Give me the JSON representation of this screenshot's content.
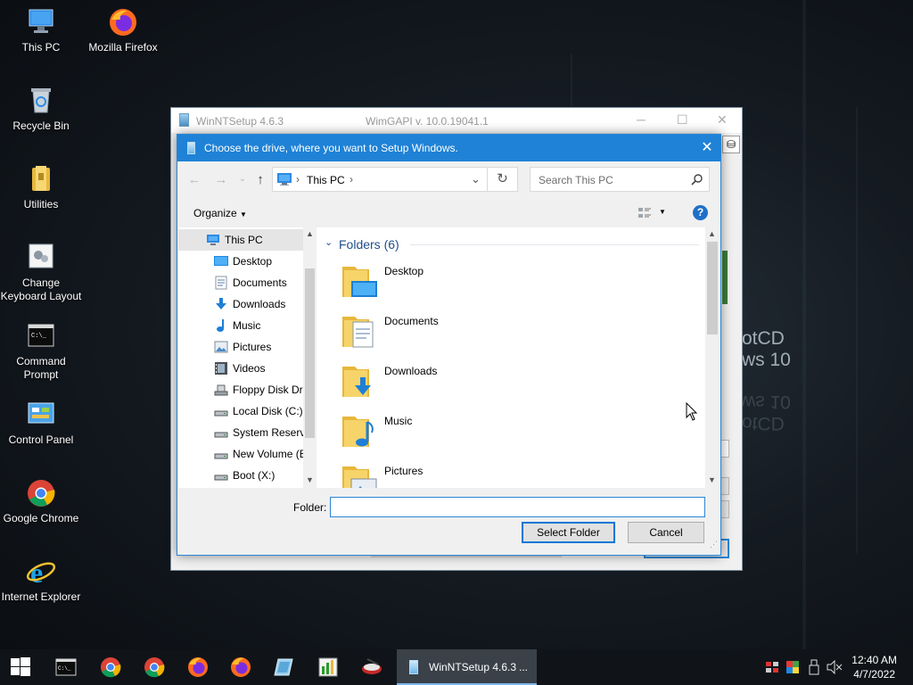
{
  "desktop": {
    "icons": [
      {
        "label": "This PC",
        "icon": "this-pc-icon"
      },
      {
        "label": "Mozilla Firefox",
        "icon": "firefox-icon"
      },
      {
        "label": "Recycle Bin",
        "icon": "recycle-bin-icon"
      },
      {
        "label": "Utilities",
        "icon": "folder-icon"
      },
      {
        "label": "Change Keyboard Layout",
        "icon": "keyboard-icon"
      },
      {
        "label": "Command Prompt",
        "icon": "cmd-icon"
      },
      {
        "label": "Control Panel",
        "icon": "control-panel-icon"
      },
      {
        "label": "Google Chrome",
        "icon": "chrome-icon"
      },
      {
        "label": "Internet Explorer",
        "icon": "ie-icon"
      }
    ],
    "wallpaper_text": "otCD\nws 10"
  },
  "background_window": {
    "title": "WinNTSetup 4.6.3",
    "subtitle": "WimGAPI v. 10.0.19041.1"
  },
  "dialog": {
    "title": "Choose the drive, where you want to Setup Windows.",
    "address": {
      "root": "This PC"
    },
    "search_placeholder": "Search This PC",
    "organize_label": "Organize",
    "help_label": "?",
    "tree": [
      {
        "label": "This PC",
        "icon": "this-pc-icon",
        "selected": true
      },
      {
        "label": "Desktop",
        "icon": "desktop-folder-icon"
      },
      {
        "label": "Documents",
        "icon": "documents-icon"
      },
      {
        "label": "Downloads",
        "icon": "downloads-icon"
      },
      {
        "label": "Music",
        "icon": "music-icon"
      },
      {
        "label": "Pictures",
        "icon": "pictures-icon"
      },
      {
        "label": "Videos",
        "icon": "videos-icon"
      },
      {
        "label": "Floppy Disk Dri",
        "icon": "floppy-drive-icon"
      },
      {
        "label": "Local Disk (C:)",
        "icon": "drive-icon"
      },
      {
        "label": "System Reserve",
        "icon": "drive-icon"
      },
      {
        "label": "New Volume (E",
        "icon": "drive-icon"
      },
      {
        "label": "Boot (X:)",
        "icon": "drive-icon"
      }
    ],
    "group_header": "Folders (6)",
    "folders": [
      {
        "label": "Desktop",
        "icon": "desktop-folder-icon"
      },
      {
        "label": "Documents",
        "icon": "documents-folder-icon"
      },
      {
        "label": "Downloads",
        "icon": "downloads-folder-icon"
      },
      {
        "label": "Music",
        "icon": "music-folder-icon"
      },
      {
        "label": "Pictures",
        "icon": "pictures-folder-icon"
      }
    ],
    "folder_label": "Folder:",
    "folder_value": "",
    "select_button": "Select Folder",
    "cancel_button": "Cancel"
  },
  "taskbar": {
    "active_window": "WinNTSetup 4.6.3",
    "active_suffix": "...",
    "time": "12:40 AM",
    "date": "4/7/2022"
  },
  "colors": {
    "accent": "#1f82d6",
    "selection": "#cce8ff"
  }
}
